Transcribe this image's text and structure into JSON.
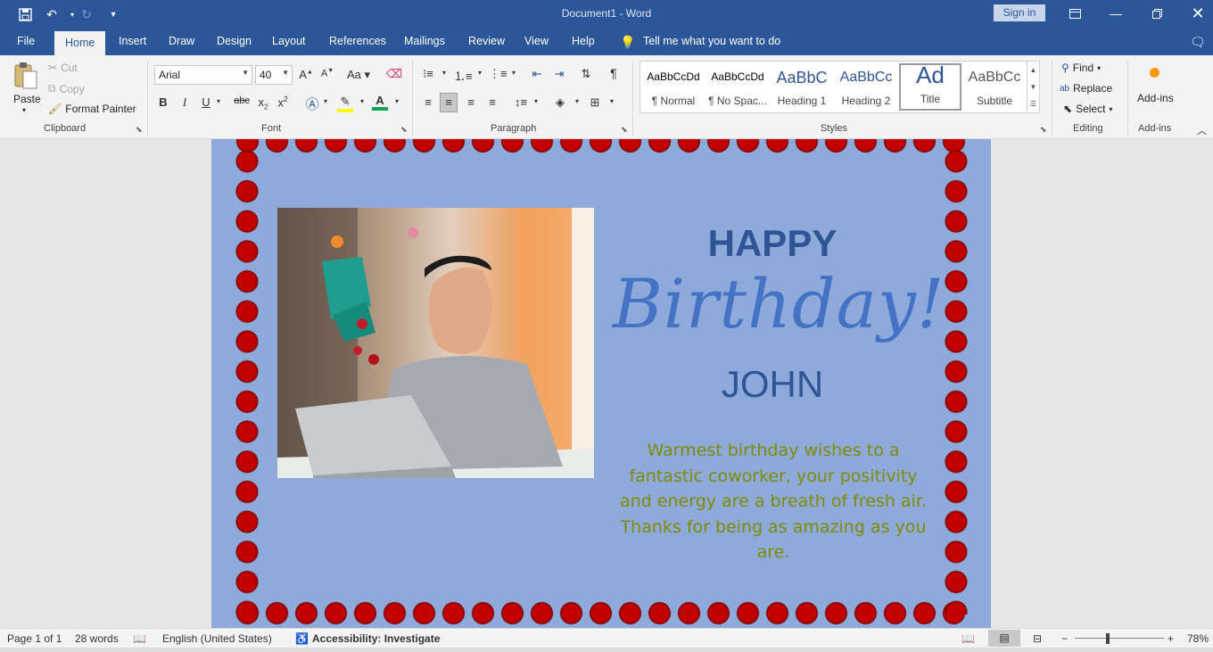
{
  "titlebar": {
    "title": "Document1 - Word",
    "sign_in": "Sign in"
  },
  "tabs": [
    "File",
    "Home",
    "Insert",
    "Draw",
    "Design",
    "Layout",
    "References",
    "Mailings",
    "Review",
    "View",
    "Help"
  ],
  "tell_me": "Tell me what you want to do",
  "clipboard": {
    "paste": "Paste",
    "cut": "Cut",
    "copy": "Copy",
    "format_painter": "Format Painter",
    "group": "Clipboard"
  },
  "font": {
    "name": "Arial",
    "size": "40",
    "group": "Font"
  },
  "paragraph": {
    "group": "Paragraph"
  },
  "styles": {
    "group": "Styles",
    "items": [
      {
        "preview": "AaBbCcDd",
        "name": "¶ Normal"
      },
      {
        "preview": "AaBbCcDd",
        "name": "¶ No Spac..."
      },
      {
        "preview": "AaBbC",
        "name": "Heading 1"
      },
      {
        "preview": "AaBbCc",
        "name": "Heading 2"
      },
      {
        "preview": "Ad",
        "name": "Title"
      },
      {
        "preview": "AaBbCc",
        "name": "Subtitle"
      }
    ]
  },
  "editing": {
    "find": "Find",
    "replace": "Replace",
    "select": "Select",
    "group": "Editing"
  },
  "addins": {
    "label": "Add-ins",
    "group": "Add-ins"
  },
  "card": {
    "happy": "HAPPY",
    "birthday": "Birthday!",
    "name": "JOHN",
    "message": "Warmest birthday wishes to a fantastic coworker, your positivity and energy are a breath of fresh air. Thanks for being as amazing as you are."
  },
  "status": {
    "page": "Page 1 of 1",
    "words": "28 words",
    "language": "English (United States)",
    "accessibility": "Accessibility: Investigate",
    "zoom": "78%"
  },
  "colors": {
    "brand": "#2b579a",
    "page_bg": "#8eaadb",
    "border": "#c00000"
  }
}
